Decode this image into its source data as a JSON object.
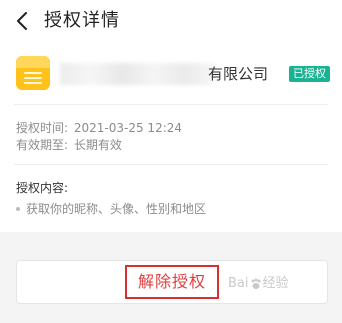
{
  "header": {
    "title": "授权详情",
    "back_icon": "chevron-left-icon"
  },
  "app": {
    "icon": "folder-icon",
    "company_name": "有限公司",
    "status_badge": "已授权",
    "badge_color": "#19b394",
    "icon_color": "#ffc21a"
  },
  "details": {
    "auth_time_label": "授权时间:",
    "auth_time_value": "2021-03-25 12:24",
    "valid_until_label": "有效期至:",
    "valid_until_value": "长期有效"
  },
  "content": {
    "title": "授权内容:",
    "items": [
      "获取你的昵称、头像、性别和地区"
    ]
  },
  "actions": {
    "revoke_label": "解除授权",
    "revoke_color": "#e03e3e"
  },
  "watermark": {
    "brand": "Bai",
    "brand_suffix": "经验",
    "paw_icon": "paw-icon"
  }
}
